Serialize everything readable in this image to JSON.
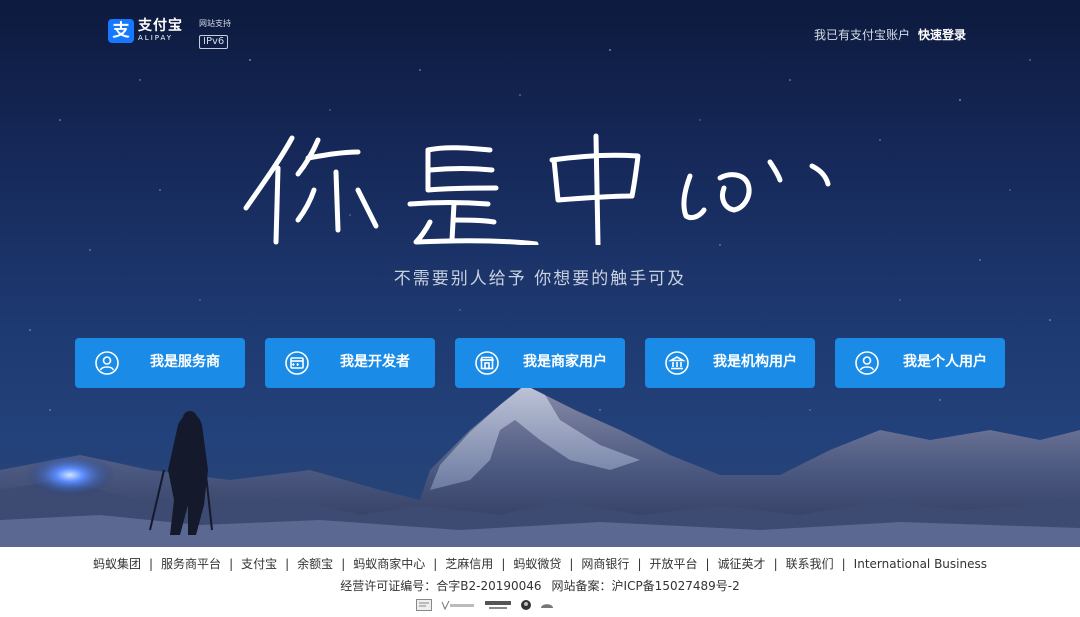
{
  "header": {
    "logo_cn": "支付宝",
    "logo_en": "ALIPAY",
    "logo_mark": "支",
    "ipv6_caption": "网站支持",
    "ipv6_label": "IPv6",
    "account_prompt": "我已有支付宝账户",
    "login_label": "快速登录"
  },
  "hero": {
    "headline_calligraphy": "你是中心",
    "slogan": "不需要别人给予  你想要的触手可及"
  },
  "roles": [
    {
      "label": "我是服务商",
      "icon": "user-circle-icon"
    },
    {
      "label": "我是开发者",
      "icon": "code-window-icon"
    },
    {
      "label": "我是商家用户",
      "icon": "storefront-icon"
    },
    {
      "label": "我是机构用户",
      "icon": "bank-building-icon"
    },
    {
      "label": "我是个人用户",
      "icon": "person-icon"
    }
  ],
  "footer": {
    "links": [
      "蚂蚁集团",
      "服务商平台",
      "支付宝",
      "余额宝",
      "蚂蚁商家中心",
      "芝麻信用",
      "蚂蚁微贷",
      "网商银行",
      "开放平台",
      "诚征英才",
      "联系我们",
      "International Business"
    ],
    "separator": "|",
    "license": "经营许可证编号：合字B2-20190046",
    "icp": "网站备案：沪ICP备15027489号-2",
    "badges": [
      "cert-badge-icon",
      "verisign-badge-icon",
      "verified-by-visa-badge-icon",
      "police-badge-icon",
      "trust-badge-icon"
    ]
  },
  "colors": {
    "role_button": "#1a8ce8",
    "brand": "#1677ff",
    "sky_top": "#0d1a3e",
    "sky_bottom": "#2a4676"
  }
}
